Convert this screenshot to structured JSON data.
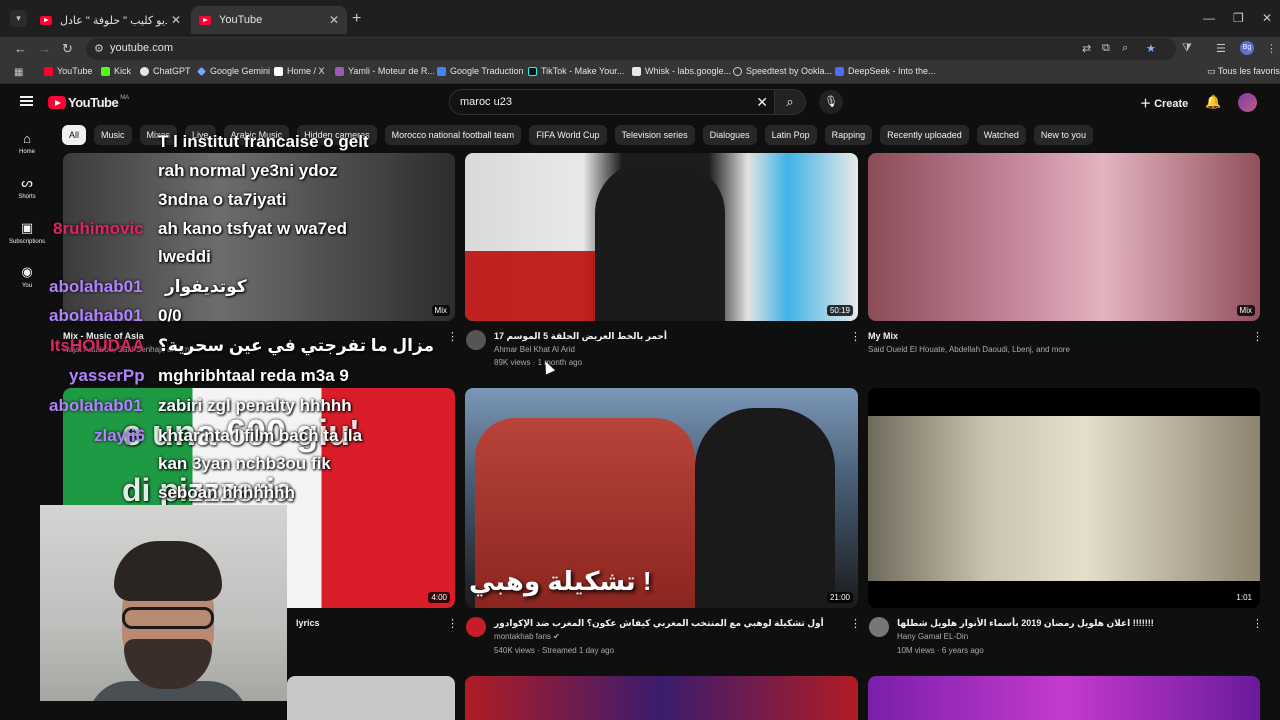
{
  "browser": {
    "tabs": [
      {
        "title": "حصري-فيديو كليب \" حلوفة \" عادل",
        "active": false
      },
      {
        "title": "YouTube",
        "active": true
      }
    ],
    "url": "youtube.com",
    "bookmarks": [
      {
        "label": "YouTube",
        "color": "#ff0033"
      },
      {
        "label": "Kick",
        "color": "#53fc18"
      },
      {
        "label": "ChatGPT",
        "color": "#e6e6e6"
      },
      {
        "label": "Google Gemini",
        "color": "#7aa7ff"
      },
      {
        "label": "Home / X",
        "color": "#ffffff"
      },
      {
        "label": "Yamli - Moteur de R...",
        "color": "#9b59b6"
      },
      {
        "label": "Google Traduction",
        "color": "#4285f4"
      },
      {
        "label": "TikTok - Make Your...",
        "color": "#25f4ee"
      },
      {
        "label": "Whisk - labs.google...",
        "color": "#e6e6e6"
      },
      {
        "label": "Speedtest by Ookla...",
        "color": "#cccccc"
      },
      {
        "label": "DeepSeek - Into the...",
        "color": "#4d6bfe"
      }
    ],
    "bookmark_folder": "Tous les favoris"
  },
  "youtube": {
    "logo_text": "YouTube",
    "country_code": "MA",
    "search_value": "maroc u23",
    "create_label": "Create",
    "rail": [
      {
        "label": "Home",
        "icon": "home-icon"
      },
      {
        "label": "Shorts",
        "icon": "shorts-icon"
      },
      {
        "label": "Subscriptions",
        "icon": "subscriptions-icon"
      },
      {
        "label": "You",
        "icon": "you-icon"
      }
    ],
    "chips": [
      "All",
      "Music",
      "Mixes",
      "Live",
      "Arabic Music",
      "Hidden cameras",
      "Morocco national football team",
      "FIFA World Cup",
      "Television series",
      "Dialogues",
      "Latin Pop",
      "Rapping",
      "Recently uploaded",
      "Watched",
      "New to you"
    ],
    "videos": [
      {
        "title": "Mix - Music of Asia",
        "channel": "Najat Aatabou, Said Senhaji, and more",
        "stats": "",
        "duration": "Mix"
      },
      {
        "title": "17 أحمر بالخط العريض الحلقة 5 الموسم",
        "channel": "Ahmar Bel Khat Al Arid",
        "stats": "89K views · 1 month ago",
        "duration": "50:19"
      },
      {
        "title": "My Mix",
        "channel": "Said Oueld El Houate, Abdellah Daoudi, Lbenj, and more",
        "stats": "",
        "duration": "Mix"
      },
      {
        "title": "lyrics",
        "channel": "",
        "stats": "",
        "duration": "4:00"
      },
      {
        "title": "أول تشكيلة لوهبي مع المنتخب المغربي كيفاش عكون؟ المغرب ضد الإكوادور",
        "channel": "montakhab fans",
        "stats": "540K views · Streamed 1 day ago",
        "duration": "21:00",
        "thumb_text": "تشكيلة وهبي !"
      },
      {
        "title": "اعلان هلويل رمضان 2019 بأسماء الأنوار هلويل شطلها !!!!!!!",
        "channel": "Hany Gamal EL-Din",
        "stats": "10M views · 6 years ago",
        "duration": "1:01"
      }
    ]
  },
  "overlay": {
    "chat": [
      {
        "user": "",
        "text": "T l institut francaise o gelt"
      },
      {
        "user": "",
        "text": "rah normal ye3ni ydoz"
      },
      {
        "user": "",
        "text": "3ndna o ta7iyati"
      },
      {
        "user": "8ruhimovic",
        "text": "ah kano tsfyat w wa7ed"
      },
      {
        "user": "",
        "text": "lweddi"
      },
      {
        "user": "abolahab01",
        "text": "كوتديفوار"
      },
      {
        "user": "abolahab01",
        "text": "0/0"
      },
      {
        "user": "ItsHOUDAA",
        "text": "مزال ما تفرجتي في عين سحرية؟"
      },
      {
        "user": "yasserPp",
        "text": "mghribhtaal reda m3a 9"
      },
      {
        "user": "abolahab01",
        "text": "zabiri zgl penalty hhhhh"
      },
      {
        "user": "zlayji6",
        "text": "khtar nta l film bach ta ila"
      },
      {
        "user": "",
        "text": "kan 3yan nchb3ou fik"
      },
      {
        "user": "",
        "text": "seboan hhhhhhh"
      }
    ],
    "thumb_overlay_texts": [
      "e una 600 giu'",
      "di pizzzeria"
    ]
  }
}
